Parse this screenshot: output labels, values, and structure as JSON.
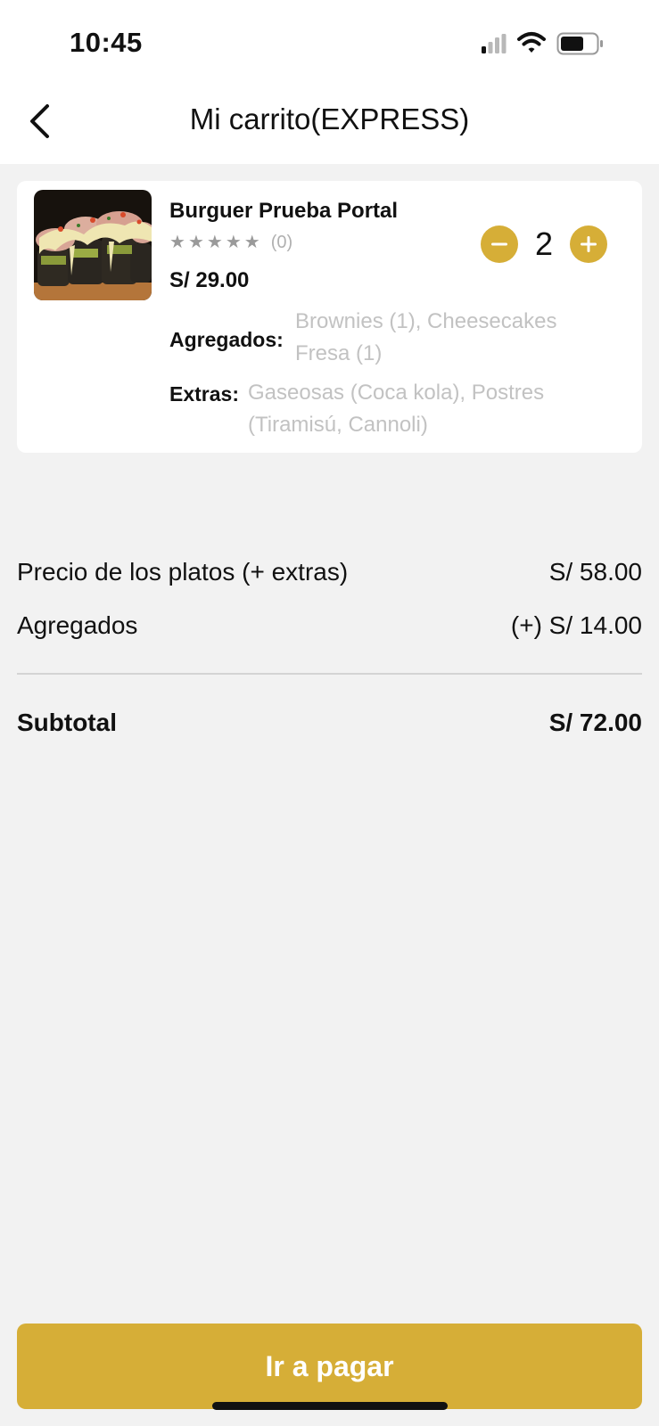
{
  "status_bar": {
    "time": "10:45"
  },
  "header": {
    "title": "Mi carrito(EXPRESS)"
  },
  "cart_item": {
    "name": "Burguer Prueba Portal",
    "rating_value": 0,
    "rating_max": 5,
    "rating_count": "(0)",
    "price": "S/ 29.00",
    "quantity": "2",
    "agregados_label": "Agregados:",
    "agregados_line1": "Brownies (1),  Cheesecakes",
    "agregados_line2": "Fresa (1)",
    "extras_label": "Extras:",
    "extras_line1": "Gaseosas (Coca kola), Postres",
    "extras_line2": "(Tiramisú, Cannoli)"
  },
  "summary": {
    "platos_label": "Precio de los platos (+ extras)",
    "platos_value": "S/ 58.00",
    "agregados_label": "Agregados",
    "agregados_value": "(+) S/ 14.00",
    "subtotal_label": "Subtotal",
    "subtotal_value": "S/ 72.00"
  },
  "footer": {
    "pay_label": "Ir a pagar"
  },
  "colors": {
    "accent": "#d6ae37",
    "background": "#f2f2f2",
    "muted_text": "#c2c2c2"
  }
}
